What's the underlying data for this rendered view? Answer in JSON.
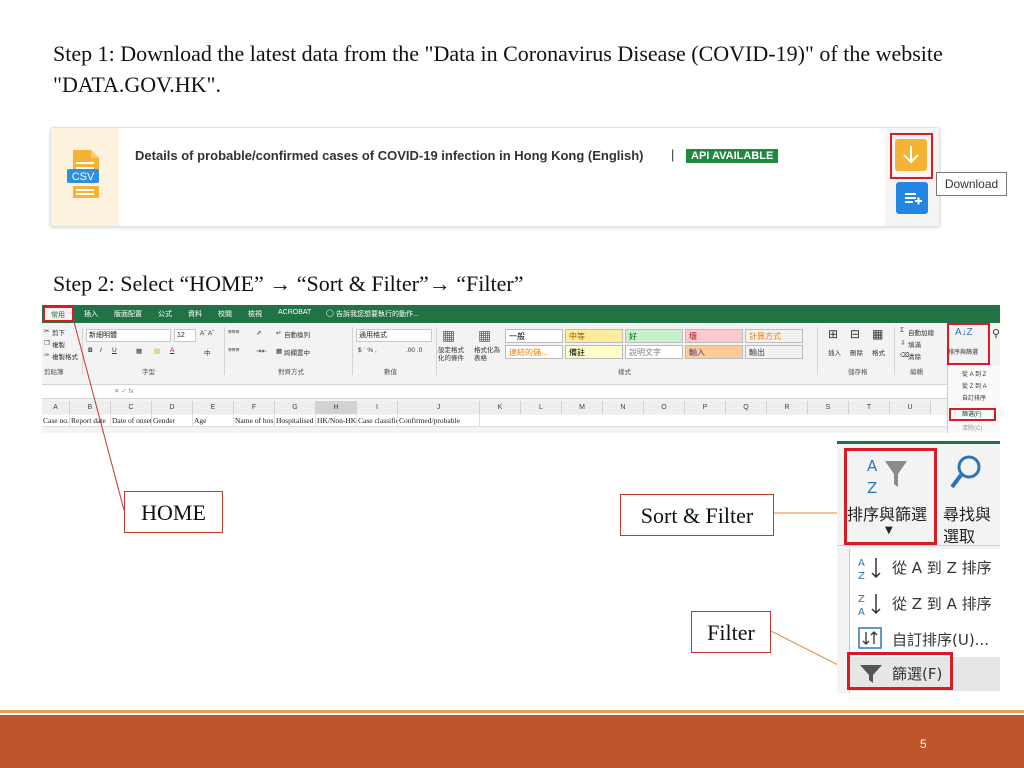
{
  "step1": {
    "text": "Step 1: Download the latest data from the \"Data in Coronavirus Disease (COVID-19)\" of the website \"DATA.GOV.HK\"."
  },
  "dataset_card": {
    "file_type": "CSV",
    "title": "Details of probable/confirmed cases of COVID-19 infection in Hong Kong (English)",
    "separator": "|",
    "badge": "API AVAILABLE",
    "download_icon": "download-arrow-icon",
    "add_icon": "add-to-list-icon",
    "tooltip": "Download",
    "colors": {
      "download_button": "#f5b335",
      "add_button": "#2386e0",
      "badge": "#1e8a3e",
      "highlight": "#d81b25"
    }
  },
  "step2": {
    "text": "Step 2: Select “HOME” → “Sort & Filter”→ “Filter”"
  },
  "excel": {
    "tabs": [
      "常用",
      "插入",
      "版面配置",
      "公式",
      "資料",
      "校閱",
      "檢視",
      "ACROBAT"
    ],
    "tell_me": "告訴我您想要執行的動作...",
    "clipboard": {
      "cut": "剪下",
      "copy": "複製",
      "format_painter": "複製格式"
    },
    "font_name": "新細明體",
    "font_size": "12",
    "wrap_text": "自動換列",
    "merge_center": "跨欄置中",
    "number_format": "通用格式",
    "conditional_format": "設定格式化的條件",
    "format_as_table": "格式化為表格",
    "styles": [
      {
        "label": "一般",
        "bg": "#ffffff",
        "fg": "#000000"
      },
      {
        "label": "中等",
        "bg": "#ffeb9c",
        "fg": "#9c5700"
      },
      {
        "label": "好",
        "bg": "#c6efce",
        "fg": "#006100"
      },
      {
        "label": "壞",
        "bg": "#ffc7ce",
        "fg": "#9c0006"
      },
      {
        "label": "計算方式",
        "bg": "#f2f2f2",
        "fg": "#fa7d00"
      },
      {
        "label": "連結的儲...",
        "bg": "#ffffff",
        "fg": "#fa7d00"
      },
      {
        "label": "備註",
        "bg": "#ffffcc",
        "fg": "#000000"
      },
      {
        "label": "說明文字",
        "bg": "#ffffff",
        "fg": "#7f7f7f"
      },
      {
        "label": "輸入",
        "bg": "#ffcc99",
        "fg": "#3f3f76"
      },
      {
        "label": "輸出",
        "bg": "#f2f2f2",
        "fg": "#3f3f3f"
      }
    ],
    "cells_group": {
      "insert": "插入",
      "delete": "刪除",
      "format": "格式"
    },
    "autosum": "自動加總",
    "fill": "填滿",
    "clear": "清除",
    "sort_filter_small": "排序與篩選",
    "find_small": "尋找與選取",
    "group_labels": {
      "clipboard": "剪貼簿",
      "font": "字型",
      "alignment": "對齊方式",
      "number": "數值",
      "styles": "樣式",
      "cells": "儲存格",
      "editing": "編輯"
    },
    "sort_menu_small": [
      "從 A 到 Z",
      "從 Z 到 A",
      "自訂排序",
      "篩選(F)",
      "清除(C)"
    ],
    "columns": [
      "A",
      "B",
      "C",
      "D",
      "E",
      "F",
      "G",
      "H",
      "I",
      "J",
      "K",
      "L",
      "M",
      "N",
      "O",
      "P",
      "Q",
      "R",
      "S",
      "T",
      "U"
    ],
    "selected_column": "H",
    "row1": [
      "Case no.",
      "Report date",
      "Date of onset",
      "Gender",
      "Age",
      "Name of hospital",
      "Hospitalised",
      "HK/Non-HK",
      "Case classification",
      "Confirmed/probable"
    ]
  },
  "callouts": {
    "home": "HOME",
    "sort_filter": "Sort & Filter",
    "filter": "Filter"
  },
  "zoom": {
    "sort_filter_label_line1": "排序與篩選",
    "find_label_line1": "尋找與",
    "find_label_line2": "選取",
    "menu": [
      {
        "icon": "sort-a-to-z-icon",
        "label": "從 A 到 Z 排序"
      },
      {
        "icon": "sort-z-to-a-icon",
        "label": "從 Z 到 A 排序"
      },
      {
        "icon": "custom-sort-icon",
        "label": "自訂排序(U)..."
      },
      {
        "icon": "filter-funnel-icon",
        "label": "篩選(F)"
      }
    ]
  },
  "footer": {
    "page_number": "5",
    "colors": {
      "bar": "#c0542a",
      "accent_line": "#e7a14a"
    }
  }
}
